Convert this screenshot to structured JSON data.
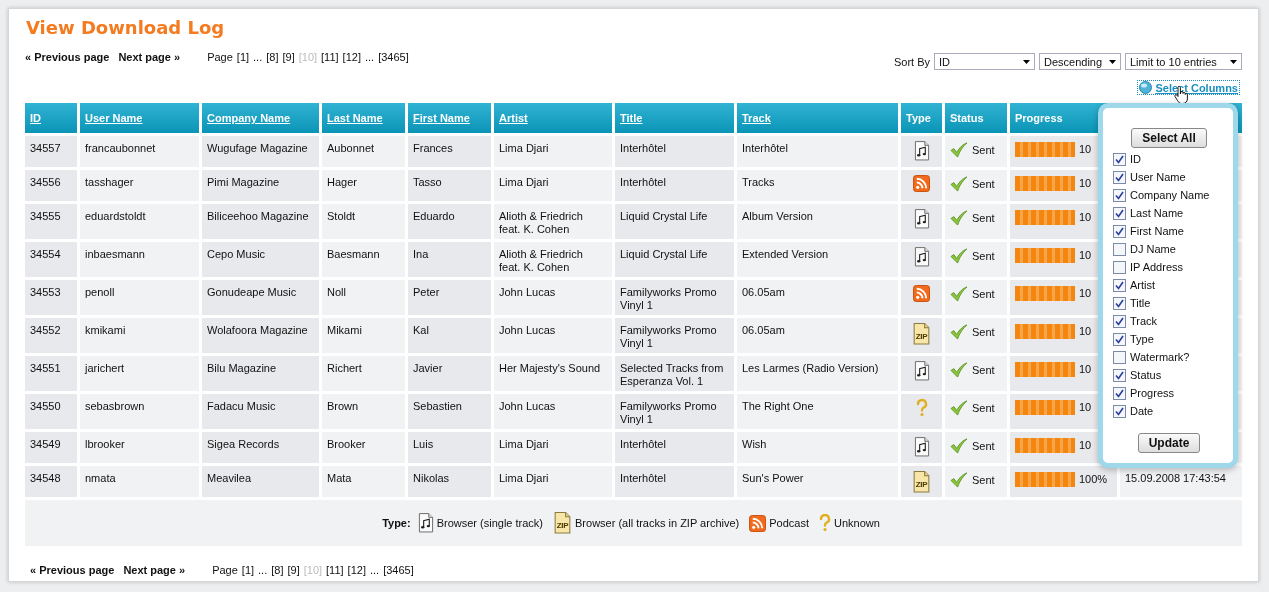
{
  "title": "View Download Log",
  "pager_top": {
    "previous": "« Previous page",
    "next": "Next page »",
    "label": "Page",
    "pages": [
      {
        "kind": "page",
        "text": "[1]",
        "selected": false
      },
      {
        "kind": "gap",
        "text": "..."
      },
      {
        "kind": "page",
        "text": "[8]",
        "selected": false
      },
      {
        "kind": "page",
        "text": "[9]",
        "selected": false
      },
      {
        "kind": "page",
        "text": "[10]",
        "selected": true
      },
      {
        "kind": "page",
        "text": "[11]",
        "selected": false
      },
      {
        "kind": "page",
        "text": "[12]",
        "selected": false
      },
      {
        "kind": "gap",
        "text": "..."
      },
      {
        "kind": "page",
        "text": "[3465]",
        "selected": false
      }
    ]
  },
  "sort": {
    "label": "Sort By",
    "field": "ID",
    "order": "Descending",
    "limit": "Limit to 10 entries"
  },
  "select_columns_link": "Select Columns",
  "table": {
    "columns": [
      {
        "label": "ID",
        "sortable": true
      },
      {
        "label": "User Name",
        "sortable": true
      },
      {
        "label": "Company Name",
        "sortable": true
      },
      {
        "label": "Last Name",
        "sortable": true
      },
      {
        "label": "First Name",
        "sortable": true
      },
      {
        "label": "Artist",
        "sortable": true
      },
      {
        "label": "Title",
        "sortable": true
      },
      {
        "label": "Track",
        "sortable": true
      },
      {
        "label": "Type",
        "sortable": false
      },
      {
        "label": "Status",
        "sortable": false
      },
      {
        "label": "Progress",
        "sortable": false
      }
    ],
    "rows": [
      {
        "id": "34557",
        "user": "francaubonnet",
        "company": "Wugufage Magazine",
        "last": "Aubonnet",
        "first": "Frances",
        "artist": "Lima Djari",
        "title": "Interhôtel",
        "track": "Interhôtel",
        "kind": "single",
        "status": "Sent",
        "level": 1,
        "progress": "10"
      },
      {
        "id": "34556",
        "user": "tasshager",
        "company": "Pimi Magazine",
        "last": "Hager",
        "first": "Tasso",
        "artist": "Lima Djari",
        "title": "Interhôtel",
        "track": "Tracks",
        "kind": "podcast",
        "status": "Sent",
        "level": 1,
        "progress": "10"
      },
      {
        "id": "34555",
        "user": "eduardstoldt",
        "company": "Biliceehoo Magazine",
        "last": "Stoldt",
        "first": "Eduardo",
        "artist": "Alioth & Friedrich feat. K. Cohen",
        "title": "Liquid Crystal Life",
        "track": "Album Version",
        "kind": "single",
        "status": "Sent",
        "level": 1,
        "progress": "10"
      },
      {
        "id": "34554",
        "user": "inbaesmann",
        "company": "Cepo Music",
        "last": "Baesmann",
        "first": "Ina",
        "artist": "Alioth & Friedrich feat. K. Cohen",
        "title": "Liquid Crystal Life",
        "track": "Extended Version",
        "kind": "single",
        "status": "Sent",
        "level": 1,
        "progress": "10"
      },
      {
        "id": "34553",
        "user": "penoll",
        "company": "Gonudeape Music",
        "last": "Noll",
        "first": "Peter",
        "artist": "John Lucas",
        "title": "Familyworks Promo Vinyl 1",
        "track": "06.05am",
        "kind": "podcast",
        "status": "Sent",
        "level": 1,
        "progress": "10"
      },
      {
        "id": "34552",
        "user": "kmikami",
        "company": "Wolafoora Magazine",
        "last": "Mikami",
        "first": "Kal",
        "artist": "John Lucas",
        "title": "Familyworks Promo Vinyl 1",
        "track": "06.05am",
        "kind": "zip",
        "icon_text": "ZIP",
        "status": "Sent",
        "level": 1,
        "progress": "10"
      },
      {
        "id": "34551",
        "user": "jarichert",
        "company": "Bilu Magazine",
        "last": "Richert",
        "first": "Javier",
        "artist": "Her Majesty's Sound",
        "title": "Selected Tracks from Esperanza Vol. 1",
        "track": "Les Larmes (Radio Version)",
        "kind": "single",
        "status": "Sent",
        "level": 1,
        "progress": "10"
      },
      {
        "id": "34550",
        "user": "sebasbrown",
        "company": "Fadacu Music",
        "last": "Brown",
        "first": "Sebastien",
        "artist": "John Lucas",
        "title": "Familyworks Promo Vinyl 1",
        "track": "The Right One",
        "kind": "unknown",
        "status": "Sent",
        "level": 1,
        "progress": "10"
      },
      {
        "id": "34549",
        "user": "lbrooker",
        "company": "Sigea Records",
        "last": "Brooker",
        "first": "Luis",
        "artist": "Lima Djari",
        "title": "Interhôtel",
        "track": "Wish",
        "kind": "single",
        "status": "Sent",
        "level": 1,
        "progress": "10"
      },
      {
        "id": "34548",
        "user": "nmata",
        "company": "Meavilea",
        "last": "Mata",
        "first": "Nikolas",
        "artist": "Lima Djari",
        "title": "Interhôtel",
        "track": "Sun's Power",
        "kind": "zip",
        "icon_text": "ZIP",
        "status": "Sent",
        "level": 1,
        "progress": "100%",
        "date": "15.09.2008 17:43:54"
      }
    ]
  },
  "legend": {
    "label": "Type:",
    "items": [
      {
        "kind": "single",
        "label": "Browser (single track)"
      },
      {
        "kind": "zip",
        "icon_text": "ZIP",
        "label": "Browser (all tracks in ZIP archive)"
      },
      {
        "kind": "podcast",
        "label": "Podcast"
      },
      {
        "kind": "unknown",
        "label": "Unknown"
      }
    ]
  },
  "columns_popup": {
    "select_all": "Select All",
    "update": "Update",
    "options": [
      {
        "label": "ID",
        "checked": true
      },
      {
        "label": "User Name",
        "checked": true
      },
      {
        "label": "Company Name",
        "checked": true
      },
      {
        "label": "Last Name",
        "checked": true
      },
      {
        "label": "First Name",
        "checked": true
      },
      {
        "label": "DJ Name",
        "checked": false
      },
      {
        "label": "IP Address",
        "checked": false
      },
      {
        "label": "Artist",
        "checked": true
      },
      {
        "label": "Title",
        "checked": true
      },
      {
        "label": "Track",
        "checked": true
      },
      {
        "label": "Type",
        "checked": true
      },
      {
        "label": "Watermark?",
        "checked": false
      },
      {
        "label": "Status",
        "checked": true
      },
      {
        "label": "Progress",
        "checked": true
      },
      {
        "label": "Date",
        "checked": true
      }
    ]
  },
  "pager_bottom": {
    "previous": "« Previous page",
    "next": "Next page »",
    "label": "Page",
    "pages": [
      {
        "kind": "page",
        "text": "[1]",
        "selected": false
      },
      {
        "kind": "gap",
        "text": "..."
      },
      {
        "kind": "page",
        "text": "[8]",
        "selected": false
      },
      {
        "kind": "page",
        "text": "[9]",
        "selected": false
      },
      {
        "kind": "page",
        "text": "[10]",
        "selected": true
      },
      {
        "kind": "page",
        "text": "[11]",
        "selected": false
      },
      {
        "kind": "page",
        "text": "[12]",
        "selected": false
      },
      {
        "kind": "gap",
        "text": "..."
      },
      {
        "kind": "page",
        "text": "[3465]",
        "selected": false
      }
    ]
  }
}
